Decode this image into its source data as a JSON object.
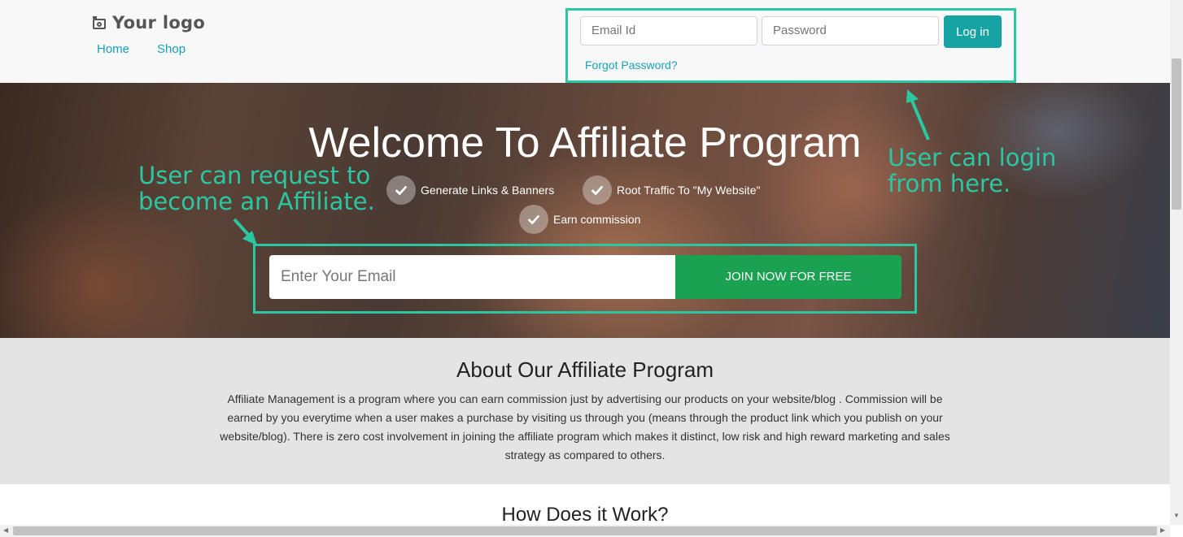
{
  "header": {
    "logo": "Your logo",
    "nav": [
      "Home",
      "Shop"
    ]
  },
  "login": {
    "email_placeholder": "Email Id",
    "password_placeholder": "Password",
    "button": "Log in",
    "forgot": "Forgot Password?"
  },
  "hero": {
    "title": "Welcome To Affiliate Program",
    "features": [
      "Generate Links & Banners",
      "Root Traffic To \"My Website\"",
      "Earn commission"
    ],
    "email_placeholder": "Enter Your Email",
    "join_button": "JOIN NOW FOR FREE"
  },
  "annotations": {
    "left_line1": "User can request to",
    "left_line2": "become an Affiliate.",
    "right_line1": "User can login",
    "right_line2": "from here.",
    "color": "#2bc7a2"
  },
  "about": {
    "title": "About Our Affiliate Program",
    "text": "Affiliate Management is a program where you can earn commission just by advertising our products on your website/blog . Commission will be earned by you everytime when a user makes a purchase by visiting us through you (means through the product link which you publish on your website/blog). There is zero cost involvement in joining the affiliate program which makes it distinct, low risk and high reward marketing and sales strategy as compared to others."
  },
  "how": {
    "title": "How Does it Work?"
  }
}
